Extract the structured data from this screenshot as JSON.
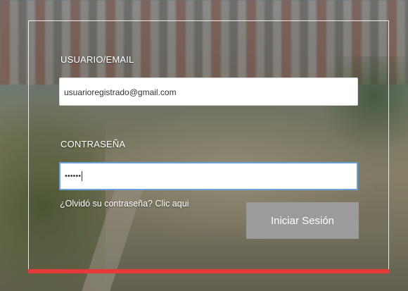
{
  "login": {
    "user_label": "USUARIO/EMAIL",
    "user_value": "usuarioregistrado@gmail.com",
    "password_label": "CONTRASEÑA",
    "password_value": "••••••",
    "forgot_link": "¿Olvidó su contraseña? Clic aqui",
    "submit_label": "Iniciar Sesión"
  },
  "colors": {
    "accent_bar": "#e53a3a",
    "button_bg": "#9b9b9b",
    "focus_border": "#6aa2d8"
  }
}
